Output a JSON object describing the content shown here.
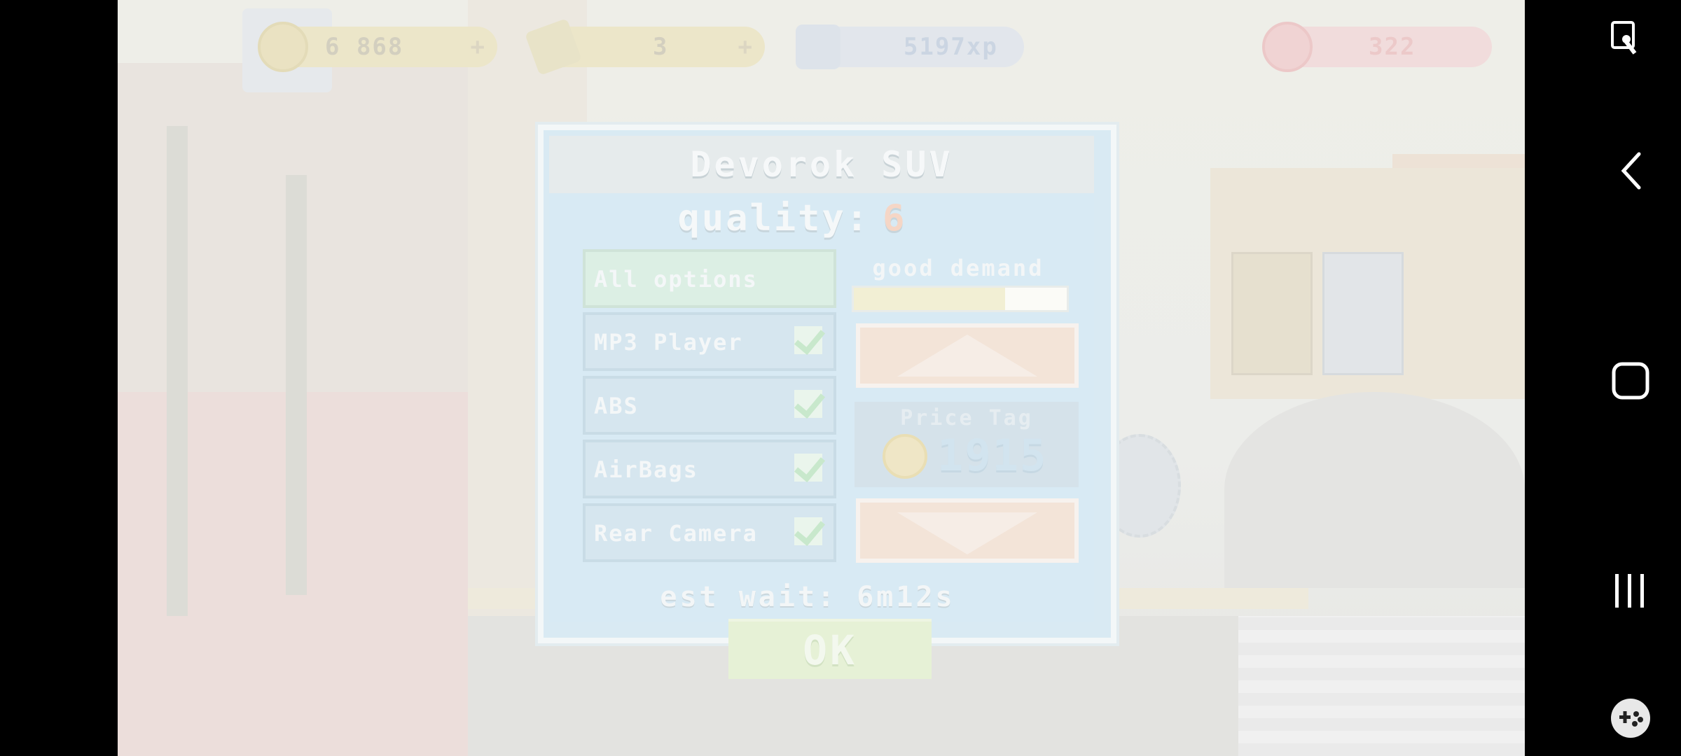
{
  "hud": {
    "coins": "6 868",
    "coins_plus": "+",
    "cash": "3",
    "cash_plus": "+",
    "xp": "5197xp",
    "money_red": "322"
  },
  "dialog": {
    "title": "Devorok SUV",
    "quality_label": "quality:",
    "quality_value": "6",
    "options": [
      {
        "label": "All options",
        "checked": false
      },
      {
        "label": "MP3 Player",
        "checked": true
      },
      {
        "label": "ABS",
        "checked": true
      },
      {
        "label": "AirBags",
        "checked": true
      },
      {
        "label": "Rear Camera",
        "checked": true
      }
    ],
    "demand_label": "good demand",
    "demand_level": 0.71,
    "price_label": "Price Tag",
    "price_value": "1915",
    "wait_text": "est wait: 6m12s",
    "ok_label": "OK"
  },
  "system_nav": [
    "touch-icon",
    "back-icon",
    "home-icon",
    "recent-apps-icon",
    "game-launcher-icon"
  ]
}
